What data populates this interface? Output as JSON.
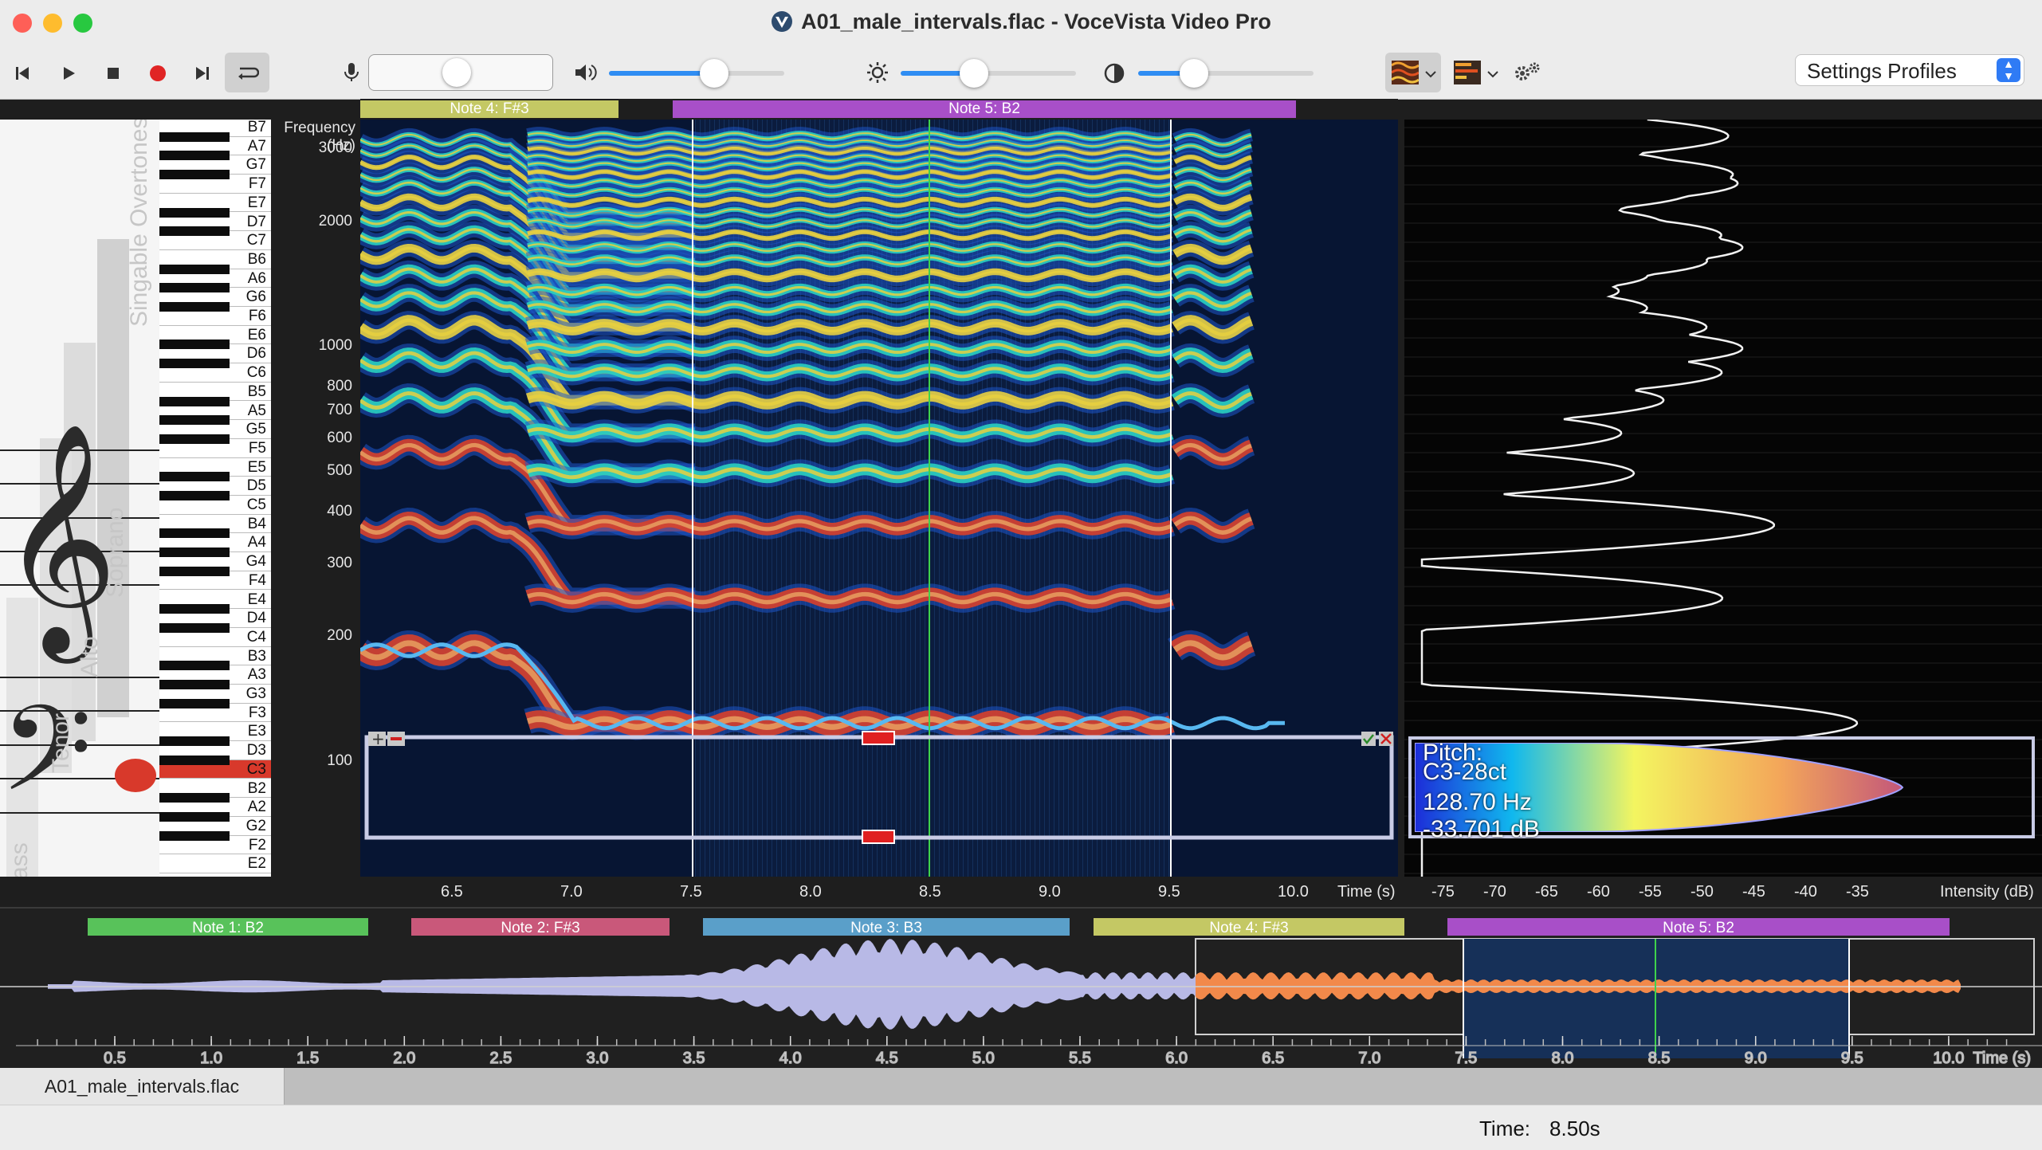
{
  "window": {
    "title": "A01_male_intervals.flac - VoceVista Video Pro"
  },
  "toolbar": {
    "buttons": [
      "skip-back",
      "play",
      "stop",
      "record",
      "skip-forward",
      "loop"
    ],
    "mic_slider": 0.45,
    "volume_slider": 0.6,
    "brightness_slider": 0.42,
    "contrast_slider": 0.32,
    "settings_profiles_label": "Settings Profiles"
  },
  "staff": {
    "vertical_labels": [
      "Singable Overtones",
      "Soprano",
      "Alto",
      "Tenor",
      "Bass"
    ]
  },
  "piano": {
    "white_keys": [
      "B7",
      "A7",
      "G7",
      "F7",
      "E7",
      "D7",
      "C7",
      "B6",
      "A6",
      "G6",
      "F6",
      "E6",
      "D6",
      "C6",
      "B5",
      "A5",
      "G5",
      "F5",
      "E5",
      "D5",
      "C5",
      "B4",
      "A4",
      "G4",
      "F4",
      "E4",
      "D4",
      "C4",
      "B3",
      "A3",
      "G3",
      "F3",
      "E3",
      "D3",
      "C3",
      "B2",
      "A2",
      "G2",
      "F2",
      "E2"
    ],
    "highlighted_key": "C3"
  },
  "spectrogram": {
    "y_axis_title": "Frequency\n(Hz)",
    "y_ticks": [
      "3000",
      "2000",
      "1000",
      "800",
      "700",
      "600",
      "500",
      "400",
      "300",
      "200",
      "100"
    ],
    "x_ticks": [
      "6.5",
      "7.0",
      "7.5",
      "8.0",
      "8.5",
      "9.0",
      "9.5",
      "10.0"
    ],
    "x_axis_title": "Time (s)",
    "notes": [
      {
        "label": "Note 4: F#3",
        "color": "#c4c864"
      },
      {
        "label": "Note 5: B2",
        "color": "#a84fc8"
      }
    ],
    "selection_start": "7.5",
    "selection_end": "9.5",
    "cursor": "8.5"
  },
  "power_spectrum": {
    "x_ticks": [
      "-75",
      "-70",
      "-65",
      "-60",
      "-55",
      "-50",
      "-45",
      "-40",
      "-35"
    ],
    "x_axis_title": "Intensity (dB)"
  },
  "pitch_readout": {
    "title": "Pitch:",
    "note": "C3-28ct",
    "frequency": "128.70 Hz",
    "level": "-33.701 dB"
  },
  "overview": {
    "notes": [
      {
        "label": "Note 1: B2",
        "color": "#58c25a"
      },
      {
        "label": "Note 2: F#3",
        "color": "#c9587a"
      },
      {
        "label": "Note 3: B3",
        "color": "#5a9fc9"
      },
      {
        "label": "Note 4: F#3",
        "color": "#c4c864"
      },
      {
        "label": "Note 5: B2",
        "color": "#a84fc8"
      }
    ],
    "x_ticks": [
      "0.5",
      "1.0",
      "1.5",
      "2.0",
      "2.5",
      "3.0",
      "3.5",
      "4.0",
      "4.5",
      "5.0",
      "5.5",
      "6.0",
      "6.5",
      "7.0",
      "7.5",
      "8.0",
      "8.5",
      "9.0",
      "9.5",
      "10.0"
    ],
    "x_axis_title": "Time (s)"
  },
  "tabs": [
    "A01_male_intervals.flac"
  ],
  "status": {
    "label": "Time:",
    "value": "8.50s"
  }
}
